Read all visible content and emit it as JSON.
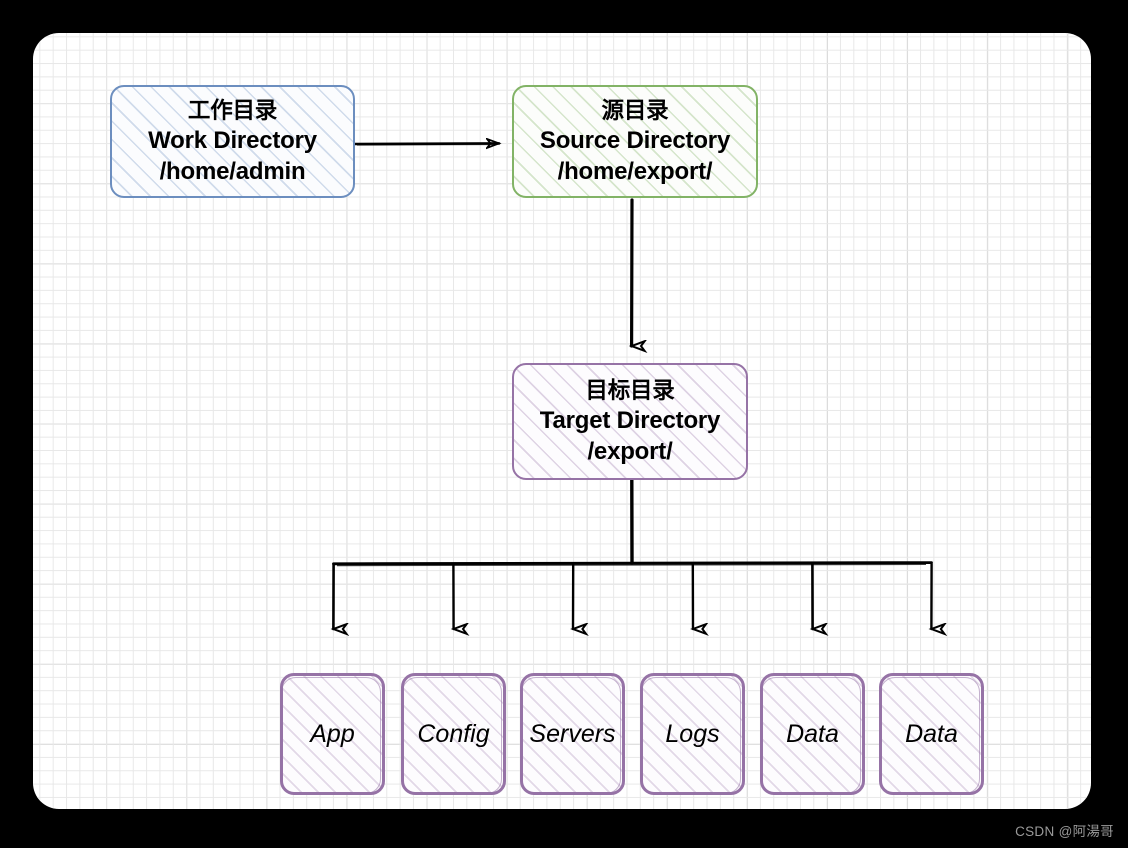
{
  "diagram": {
    "type": "directory-structure-flowchart",
    "background_color": "#000000",
    "canvas_color": "#ffffff",
    "nodes": [
      {
        "id": "work-directory",
        "color": "#6c8ebf",
        "lines": [
          "工作目录",
          "Work Directory",
          "/home/admin"
        ]
      },
      {
        "id": "source-directory",
        "color": "#82b366",
        "lines": [
          "源目录",
          "Source Directory",
          "/home/export/"
        ]
      },
      {
        "id": "target-directory",
        "color": "#9673a6",
        "lines": [
          "目标目录",
          "Target Directory",
          "/export/"
        ]
      }
    ],
    "leaves": [
      {
        "id": "leaf-app",
        "label": "App"
      },
      {
        "id": "leaf-config",
        "label": "Config"
      },
      {
        "id": "leaf-servers",
        "label": "Servers"
      },
      {
        "id": "leaf-logs",
        "label": "Logs"
      },
      {
        "id": "leaf-data-1",
        "label": "Data"
      },
      {
        "id": "leaf-data-2",
        "label": "Data"
      }
    ],
    "edges": [
      {
        "from": "work-directory",
        "to": "source-directory",
        "style": "horizontal-arrow"
      },
      {
        "from": "source-directory",
        "to": "target-directory",
        "style": "vertical-arrow"
      },
      {
        "from": "target-directory",
        "to": "leaf-app",
        "style": "tree-branch"
      },
      {
        "from": "target-directory",
        "to": "leaf-config",
        "style": "tree-branch"
      },
      {
        "from": "target-directory",
        "to": "leaf-servers",
        "style": "tree-branch"
      },
      {
        "from": "target-directory",
        "to": "leaf-logs",
        "style": "tree-branch"
      },
      {
        "from": "target-directory",
        "to": "leaf-data-1",
        "style": "tree-branch"
      },
      {
        "from": "target-directory",
        "to": "leaf-data-2",
        "style": "tree-branch"
      }
    ]
  },
  "watermark": {
    "text": "CSDN @阿湯哥"
  }
}
